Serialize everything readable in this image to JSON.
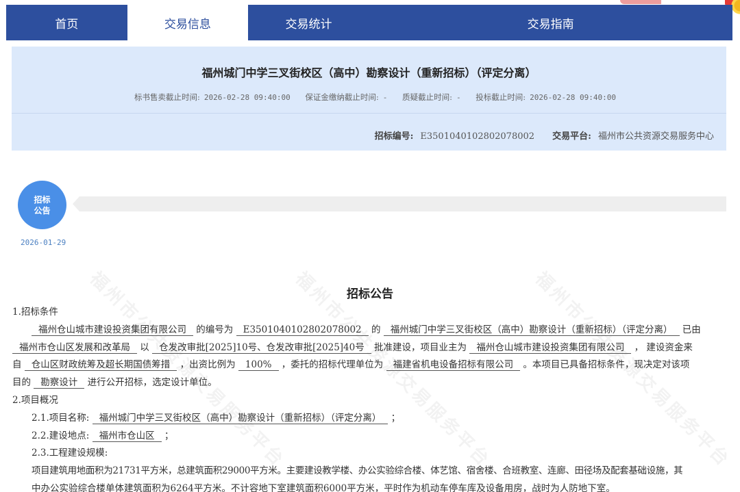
{
  "nav": {
    "items": [
      {
        "label": "首页"
      },
      {
        "label": "交易信息"
      },
      {
        "label": "交易统计"
      },
      {
        "label": ""
      },
      {
        "label": "交易指南"
      }
    ]
  },
  "project": {
    "title": "福州城门中学三叉街校区（高中）勘察设计（重新招标）（评定分离）",
    "deadlines": {
      "sale_label": "标书售卖截止时间:",
      "sale_value": "2026-02-28 09:40:00",
      "deposit_label": "保证金缴纳截止时间:",
      "deposit_value": "-",
      "query_label": "质疑截止时间:",
      "query_value": "-",
      "bid_label": "投标截止时间:",
      "bid_value": "2026-02-28 09:40:00"
    },
    "code_label": "招标编号:",
    "code_value": "E3501040102802078002",
    "platform_label": "交易平台:",
    "platform_value": "福州市公共资源交易服务中心"
  },
  "timeline": {
    "node_line1": "招标",
    "node_line2": "公告",
    "date": "2026-01-29"
  },
  "watermark": "福州市公共资源交易服务平台",
  "notice": {
    "title": "招标公告",
    "s1_heading": "1.招标条件",
    "p1_owner": "福州仓山城市建设投资集团有限公司",
    "p1_t1": "的编号为",
    "p1_code": "E3501040102802078002",
    "p1_t2": "的",
    "p1_project": "福州城门中学三叉街校区（高中）勘察设计（重新招标）（评定分离）",
    "p1_t3": "已由",
    "p2_approver": "福州市仓山区发展和改革局",
    "p2_t1": "以",
    "p2_docs": "仓发改审批[2025]10号、仓发改审批[2025]40号",
    "p2_t2": "批准建设，项目业主为",
    "p2_owner": "福州仓山城市建设投资集团有限公司",
    "p2_t3": "，  建设资金来",
    "p3_t0": "自",
    "p3_fund": "仓山区财政统筹及超长期国债筹措",
    "p3_t1": "，出资比例为",
    "p3_ratio": "100%",
    "p3_t2": "，委托的招标代理单位为",
    "p3_agent": "福建省机电设备招标有限公司",
    "p3_t3": "。本项目已具备招标条件，现决定对该项",
    "p4_t0": "目的",
    "p4_scope": "勘察设计",
    "p4_t1": "进行公开招标，选定设计单位。",
    "s2_heading": "2.项目概况",
    "s21_label": "2.1.项目名称:",
    "s21_value": "福州城门中学三叉街校区（高中）勘察设计（重新招标）（评定分离）",
    "s21_end": "；",
    "s22_label": "2.2.建设地点:",
    "s22_value": "福州市仓山区",
    "s22_end": "；",
    "s23_label": "2.3.工程建设规模:",
    "s23_line1": "项目建筑用地面积为21731平方米，总建筑面积29000平方米。主要建设教学楼、办公实验综合楼、体艺馆、宿舍楼、合班教室、连廊、田径场及配套基础设施，其",
    "s23_line2": "中办公实验综合楼单体建筑面积为6264平方米。不计容地下室建筑面积6000平方米，平时作为机动车停车库及设备用房，战时为人防地下室。"
  }
}
